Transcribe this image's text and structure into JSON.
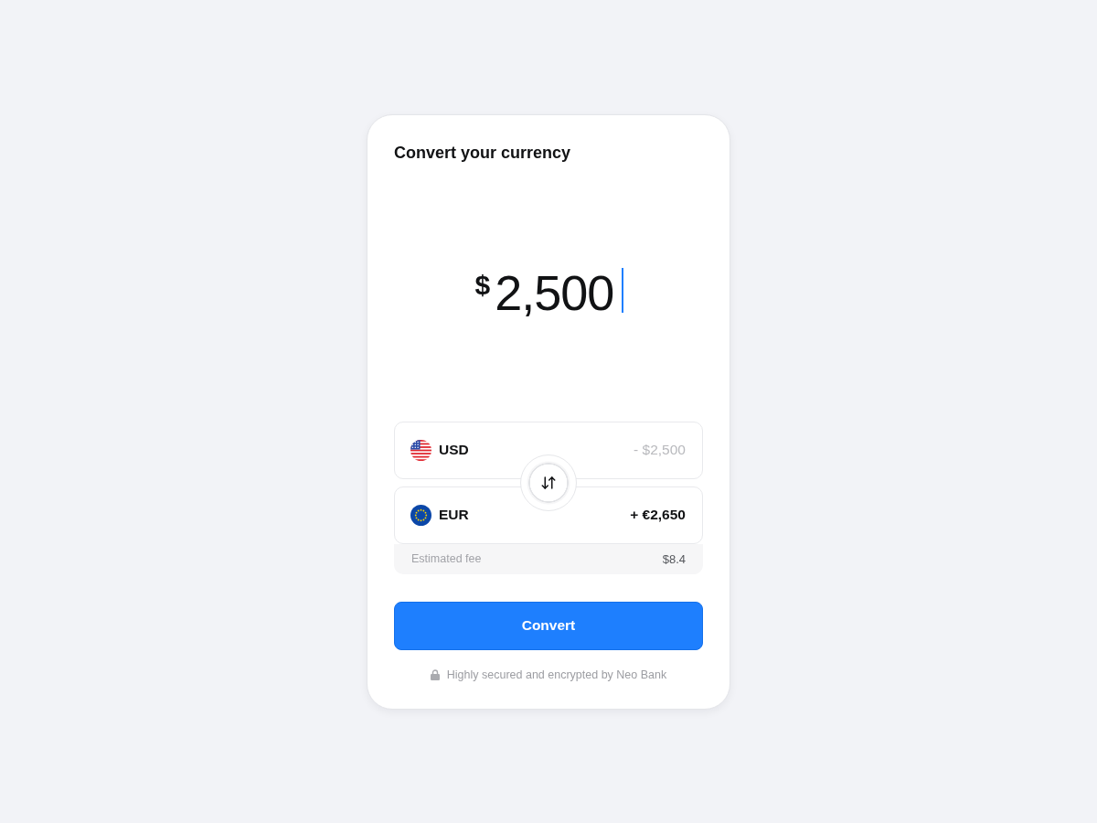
{
  "title": "Convert your currency",
  "amount": {
    "symbol": "$",
    "value": "2,500",
    "focused": true
  },
  "currencies": [
    {
      "kind": "us",
      "code": "USD",
      "muted": true,
      "change": "- $2,500"
    },
    {
      "kind": "eu",
      "code": "EUR",
      "muted": false,
      "change": "+ €2,650"
    }
  ],
  "fee": {
    "label": "Estimated fee",
    "value": "$8.4"
  },
  "convert_button": {
    "label": "Convert"
  },
  "footer": {
    "text": "Highly secured and encrypted by Neo Bank"
  }
}
